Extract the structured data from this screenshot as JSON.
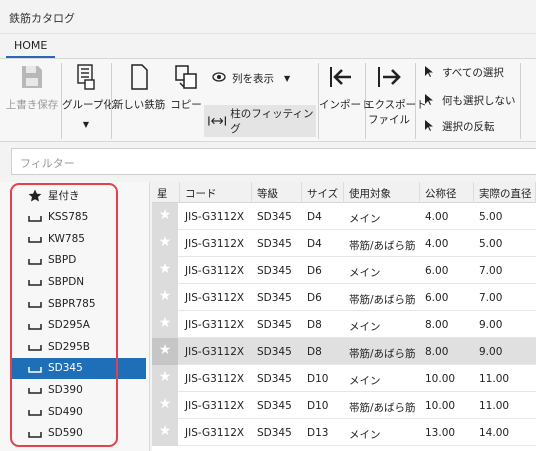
{
  "window": {
    "title": "鉄筋カタログ"
  },
  "ribbon": {
    "tab": "HOME",
    "overwrite_save": "上書き保存",
    "group_by": "グループ化",
    "new_rebar": "新しい鉄筋",
    "copy": "コピー",
    "show_columns": "列を表示",
    "column_fitting": "柱のフィッティング",
    "import": "インポート",
    "export_file_line1": "エクスポート",
    "export_file_line2": "ファイル",
    "select_all": "すべての選択",
    "select_none": "何も選択しない",
    "invert_selection": "選択の反転"
  },
  "filter": {
    "placeholder": "フィルター"
  },
  "sidebar": {
    "items": [
      {
        "label": "星付き",
        "icon": "star-icon"
      },
      {
        "label": "KSS785",
        "icon": "tray-icon"
      },
      {
        "label": "KW785",
        "icon": "tray-icon"
      },
      {
        "label": "SBPD",
        "icon": "tray-icon"
      },
      {
        "label": "SBPDN",
        "icon": "tray-icon"
      },
      {
        "label": "SBPR785",
        "icon": "tray-icon"
      },
      {
        "label": "SD295A",
        "icon": "tray-icon"
      },
      {
        "label": "SD295B",
        "icon": "tray-icon"
      },
      {
        "label": "SD345",
        "icon": "tray-icon",
        "selected": true
      },
      {
        "label": "SD390",
        "icon": "tray-icon"
      },
      {
        "label": "SD490",
        "icon": "tray-icon"
      },
      {
        "label": "SD590",
        "icon": "tray-icon"
      }
    ]
  },
  "table": {
    "headers": [
      "星",
      "コード",
      "等級",
      "サイズ",
      "使用対象",
      "公称径",
      "実際の直径"
    ],
    "rows": [
      [
        "★",
        "JIS-G3112X",
        "SD345",
        "D4",
        "メイン",
        "4.00",
        "5.00"
      ],
      [
        "★",
        "JIS-G3112X",
        "SD345",
        "D4",
        "帯筋/あばら筋",
        "4.00",
        "5.00"
      ],
      [
        "★",
        "JIS-G3112X",
        "SD345",
        "D6",
        "メイン",
        "6.00",
        "7.00"
      ],
      [
        "★",
        "JIS-G3112X",
        "SD345",
        "D6",
        "帯筋/あばら筋",
        "6.00",
        "7.00"
      ],
      [
        "★",
        "JIS-G3112X",
        "SD345",
        "D8",
        "メイン",
        "8.00",
        "9.00"
      ],
      [
        "★",
        "JIS-G3112X",
        "SD345",
        "D8",
        "帯筋/あばら筋",
        "8.00",
        "9.00"
      ],
      [
        "★",
        "JIS-G3112X",
        "SD345",
        "D10",
        "メイン",
        "10.00",
        "11.00"
      ],
      [
        "★",
        "JIS-G3112X",
        "SD345",
        "D10",
        "帯筋/あばら筋",
        "10.00",
        "11.00"
      ],
      [
        "★",
        "JIS-G3112X",
        "SD345",
        "D13",
        "メイン",
        "13.00",
        "14.00"
      ]
    ],
    "selected_row": 5
  },
  "colors": {
    "accent": "#1e6fb8",
    "highlight": "#e3424c"
  }
}
